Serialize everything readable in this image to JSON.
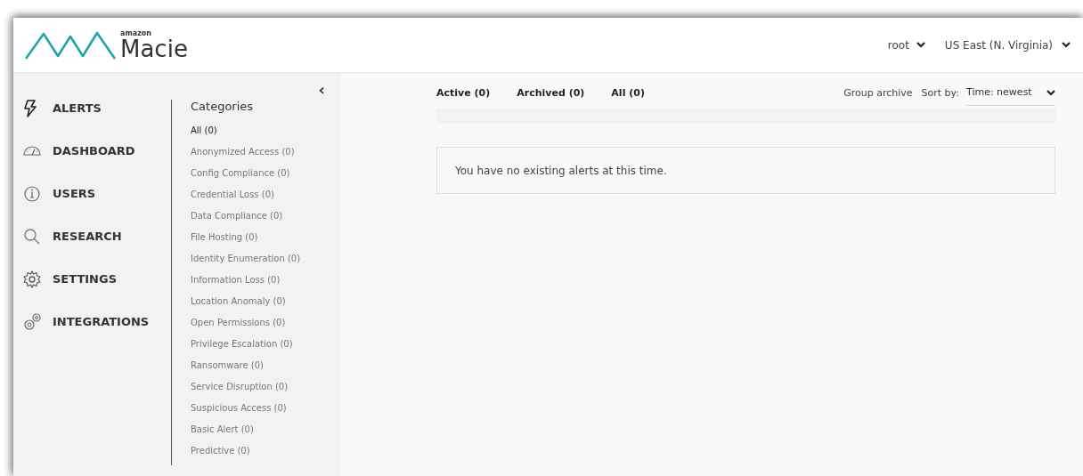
{
  "header": {
    "brand_small": "amazon",
    "brand": "Macie",
    "user": "root",
    "region": "US East (N. Virginia)"
  },
  "nav": [
    {
      "label": "ALERTS"
    },
    {
      "label": "DASHBOARD"
    },
    {
      "label": "USERS"
    },
    {
      "label": "RESEARCH"
    },
    {
      "label": "SETTINGS"
    },
    {
      "label": "INTEGRATIONS"
    }
  ],
  "collapse": "‹",
  "categories": {
    "title": "Categories",
    "items": [
      {
        "label": "All (0)",
        "selected": true
      },
      {
        "label": "Anonymized Access (0)",
        "selected": false
      },
      {
        "label": "Config Compliance (0)",
        "selected": false
      },
      {
        "label": "Credential Loss (0)",
        "selected": false
      },
      {
        "label": "Data Compliance (0)",
        "selected": false
      },
      {
        "label": "File Hosting (0)",
        "selected": false
      },
      {
        "label": "Identity Enumeration (0)",
        "selected": false
      },
      {
        "label": "Information Loss (0)",
        "selected": false
      },
      {
        "label": "Location Anomaly (0)",
        "selected": false
      },
      {
        "label": "Open Permissions (0)",
        "selected": false
      },
      {
        "label": "Privilege Escalation (0)",
        "selected": false
      },
      {
        "label": "Ransomware (0)",
        "selected": false
      },
      {
        "label": "Service Disruption (0)",
        "selected": false
      },
      {
        "label": "Suspicious Access (0)",
        "selected": false
      },
      {
        "label": "Basic Alert (0)",
        "selected": false
      },
      {
        "label": "Predictive (0)",
        "selected": false
      }
    ]
  },
  "tabs": [
    {
      "label": "Active (0)"
    },
    {
      "label": "Archived (0)"
    },
    {
      "label": "All (0)"
    }
  ],
  "group_archive": "Group archive",
  "sort_label": "Sort by:",
  "sort_value": "Time: newest",
  "empty_message": "You have no existing alerts at this time."
}
